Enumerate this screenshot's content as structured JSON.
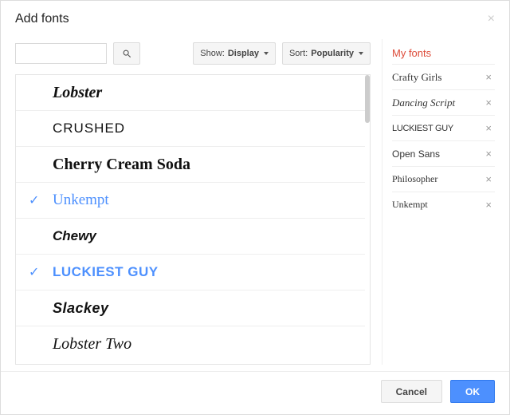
{
  "dialog": {
    "title": "Add fonts",
    "close": "×"
  },
  "search": {
    "value": "",
    "placeholder": ""
  },
  "filters": {
    "show_prefix": "Show:",
    "show_value": "Display",
    "sort_prefix": "Sort:",
    "sort_value": "Popularity"
  },
  "fonts": [
    {
      "name": "Lobster",
      "selected": false,
      "class": "f-lobster"
    },
    {
      "name": "Crushed",
      "selected": false,
      "class": "f-crushed"
    },
    {
      "name": "Cherry Cream Soda",
      "selected": false,
      "class": "f-cherry"
    },
    {
      "name": "Unkempt",
      "selected": true,
      "class": "f-unkempt"
    },
    {
      "name": "Chewy",
      "selected": false,
      "class": "f-chewy"
    },
    {
      "name": "Luckiest Guy",
      "selected": true,
      "class": "f-luckiest"
    },
    {
      "name": "Slackey",
      "selected": false,
      "class": "f-slackey"
    },
    {
      "name": "Lobster Two",
      "selected": false,
      "class": "f-lobster2"
    }
  ],
  "myfonts": {
    "title": "My fonts",
    "items": [
      {
        "name": "Crafty Girls",
        "class": "mf-crafty"
      },
      {
        "name": "Dancing Script",
        "class": "mf-dancing"
      },
      {
        "name": "Luckiest Guy",
        "class": "mf-luckiest"
      },
      {
        "name": "Open Sans",
        "class": "mf-opensans"
      },
      {
        "name": "Philosopher",
        "class": "mf-philo"
      },
      {
        "name": "Unkempt",
        "class": "mf-unkempt"
      }
    ],
    "remove": "×"
  },
  "actions": {
    "cancel": "Cancel",
    "ok": "OK"
  }
}
